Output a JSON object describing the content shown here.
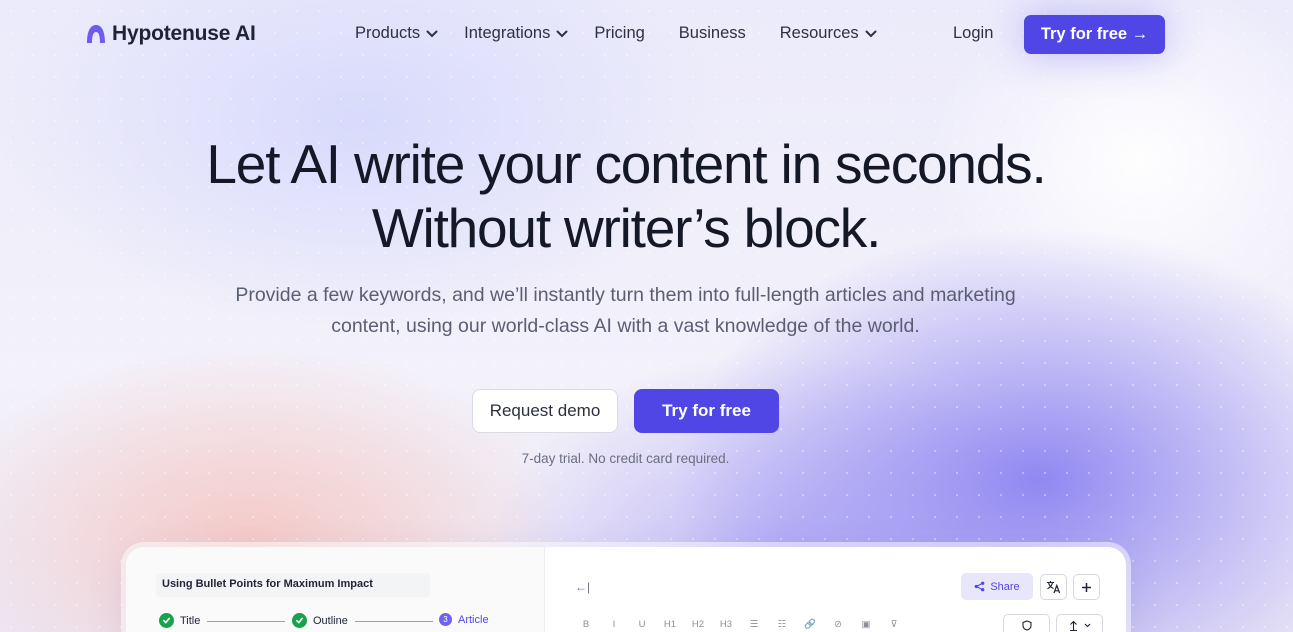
{
  "brand": {
    "name": "Hypotenuse AI",
    "accent": "#4f46e5"
  },
  "nav": {
    "items": [
      {
        "label": "Products",
        "dropdown": true
      },
      {
        "label": "Integrations",
        "dropdown": true
      },
      {
        "label": "Pricing",
        "dropdown": false
      },
      {
        "label": "Business",
        "dropdown": false
      },
      {
        "label": "Resources",
        "dropdown": true
      }
    ],
    "login": "Login",
    "cta": "Try for free →"
  },
  "hero": {
    "title_line1": "Let AI write your content in seconds.",
    "title_line2": "Without writer’s block.",
    "subtitle": "Provide a few keywords, and we’ll instantly turn them into full-length articles and marketing content, using our world-class AI with a vast knowledge of the world.",
    "demo_button": "Request demo",
    "try_button": "Try for free",
    "trial_note": "7-day trial. No credit card required."
  },
  "preview": {
    "doc_title": "Using Bullet Points for Maximum Impact",
    "steps": [
      {
        "label": "Title",
        "state": "done"
      },
      {
        "label": "Outline",
        "state": "done"
      },
      {
        "label": "Article",
        "state": "active",
        "number": "3"
      }
    ],
    "back_icon": "←|",
    "share_label": "Share",
    "toolbar": [
      "B",
      "I",
      "U",
      "H1",
      "H2",
      "H3",
      "☰",
      "☷",
      "🔗",
      "⊘",
      "▣",
      "⊽"
    ]
  }
}
